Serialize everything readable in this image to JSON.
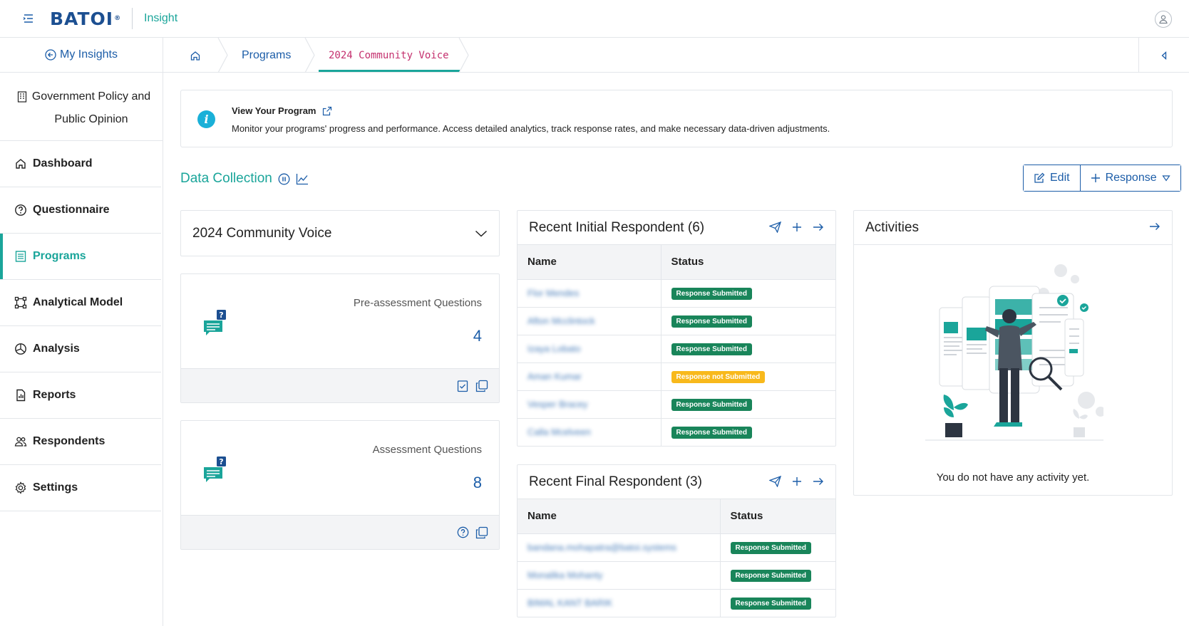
{
  "app": {
    "brand": "BATOI",
    "brand_mark": "®",
    "name": "Insight"
  },
  "sidebar": {
    "my_insights": "My Insights",
    "org_name": "Government Policy and Public Opinion",
    "items": [
      {
        "label": "Dashboard",
        "icon": "home-icon"
      },
      {
        "label": "Questionnaire",
        "icon": "question-circle-icon"
      },
      {
        "label": "Programs",
        "icon": "list-icon",
        "active": true
      },
      {
        "label": "Analytical Model",
        "icon": "model-icon"
      },
      {
        "label": "Analysis",
        "icon": "pie-chart-icon"
      },
      {
        "label": "Reports",
        "icon": "report-icon"
      },
      {
        "label": "Respondents",
        "icon": "users-icon"
      },
      {
        "label": "Settings",
        "icon": "gear-icon"
      }
    ]
  },
  "breadcrumb": {
    "programs": "Programs",
    "current": "2024 Community Voice"
  },
  "info": {
    "title": "View Your Program",
    "text": "Monitor your programs' progress and performance. Access detailed analytics, track response rates, and make necessary data-driven adjustments."
  },
  "section": {
    "title": "Data Collection"
  },
  "actions": {
    "edit": "Edit",
    "response": "Response"
  },
  "program_select": {
    "value": "2024 Community Voice"
  },
  "question_cards": [
    {
      "label": "Pre-assessment Questions",
      "count": "4"
    },
    {
      "label": "Assessment Questions",
      "count": "8"
    }
  ],
  "recent_initial": {
    "title": "Recent Initial Respondent (6)",
    "col_name": "Name",
    "col_status": "Status",
    "rows": [
      {
        "name": "Flor Mendes",
        "status": "Response Submitted",
        "state": "ok"
      },
      {
        "name": "Afton Mcclintock",
        "status": "Response Submitted",
        "state": "ok"
      },
      {
        "name": "Izaya Lobato",
        "status": "Response Submitted",
        "state": "ok"
      },
      {
        "name": "Aman Kumar",
        "status": "Response not Submitted",
        "state": "warn"
      },
      {
        "name": "Vesper Bracey",
        "status": "Response Submitted",
        "state": "ok"
      },
      {
        "name": "Calla Mcelveen",
        "status": "Response Submitted",
        "state": "ok"
      }
    ]
  },
  "recent_final": {
    "title": "Recent Final Respondent (3)",
    "col_name": "Name",
    "col_status": "Status",
    "rows": [
      {
        "name": "bandana.mohapatra@batoi.systems",
        "status": "Response Submitted",
        "state": "ok"
      },
      {
        "name": "Monalika Mohanty",
        "status": "Response Submitted",
        "state": "ok"
      },
      {
        "name": "BIMAL KANT BARIK",
        "status": "Response Submitted",
        "state": "ok"
      }
    ]
  },
  "activities": {
    "title": "Activities",
    "empty": "You do not have any activity yet."
  },
  "colors": {
    "accent": "#1aa59a",
    "link": "#1c5da8",
    "success": "#19855a",
    "warning": "#f8b91c",
    "breadcrumb_current": "#c4306e"
  }
}
